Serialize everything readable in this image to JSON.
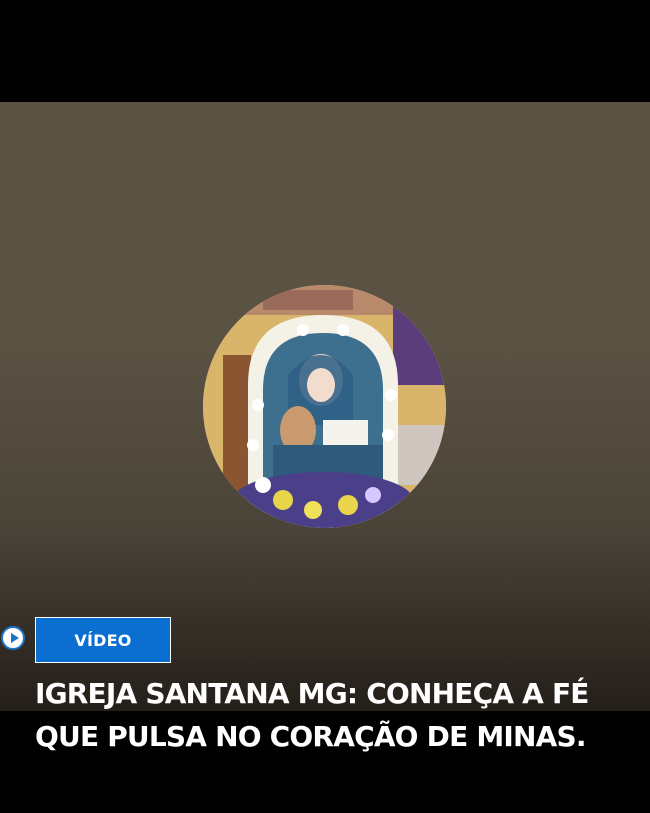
{
  "card": {
    "badge_label": "VÍDEO",
    "headline": "IGREJA SANTANA MG: CONHEÇA A FÉ QUE PULSA NO CORAÇÃO DE MINAS.",
    "play_icon": "play-circle-icon",
    "thumbnail": "religious-statue-thumbnail"
  },
  "colors": {
    "badge_bg": "#0a6fd1",
    "hero_bg": "#5a5243",
    "page_bg": "#000000",
    "text": "#ffffff"
  }
}
